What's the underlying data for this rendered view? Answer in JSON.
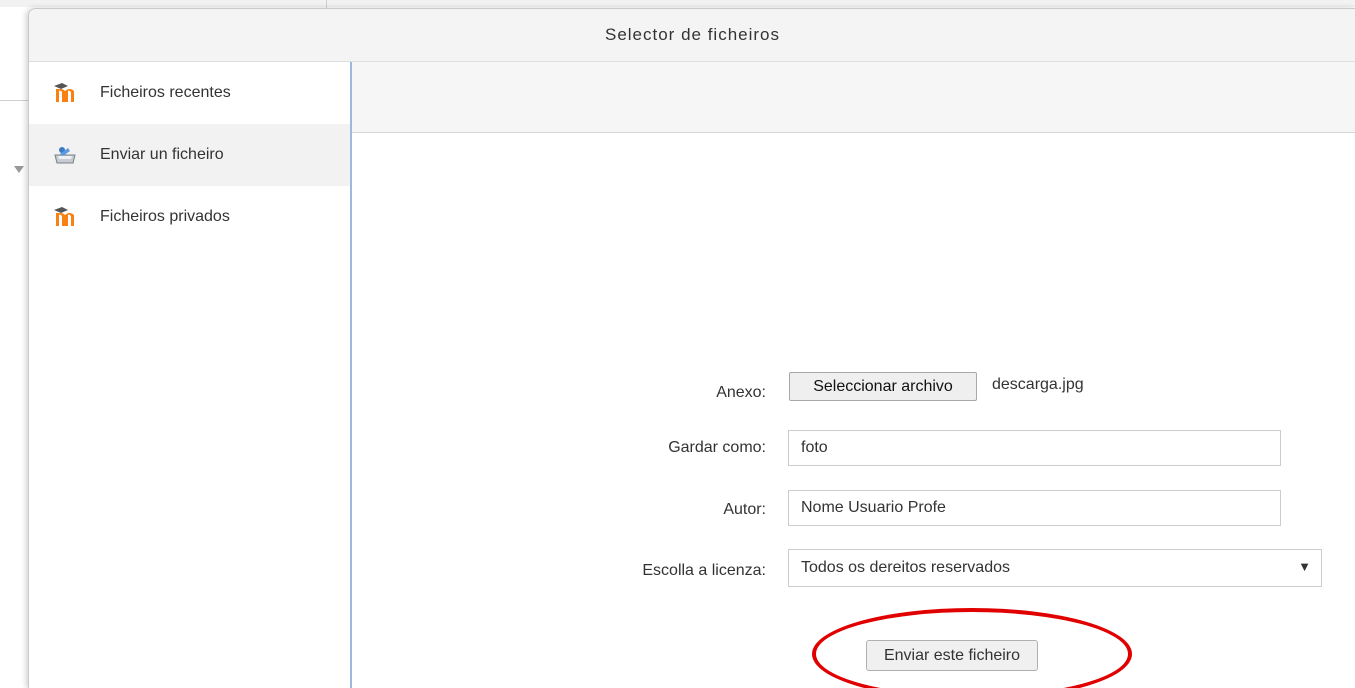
{
  "dialog": {
    "title": "Selector de ficheiros"
  },
  "sidebar": {
    "items": [
      {
        "label": "Ficheiros recentes",
        "icon": "moodle-icon",
        "active": false
      },
      {
        "label": "Enviar un ficheiro",
        "icon": "upload-icon",
        "active": true
      },
      {
        "label": "Ficheiros privados",
        "icon": "moodle-icon",
        "active": false
      }
    ]
  },
  "form": {
    "attachment_label": "Anexo:",
    "choose_file_button": "Seleccionar archivo",
    "file_name": "descarga.jpg",
    "save_as_label": "Gardar como:",
    "save_as_value": "foto",
    "author_label": "Autor:",
    "author_value": "Nome Usuario Profe",
    "license_label": "Escolla a licenza:",
    "license_value": "Todos os dereitos reservados",
    "submit_button": "Enviar este ficheiro"
  },
  "colors": {
    "moodle_orange": "#f98012",
    "annotation_red": "#e00000",
    "pane_border_blue": "#9fb8de"
  }
}
